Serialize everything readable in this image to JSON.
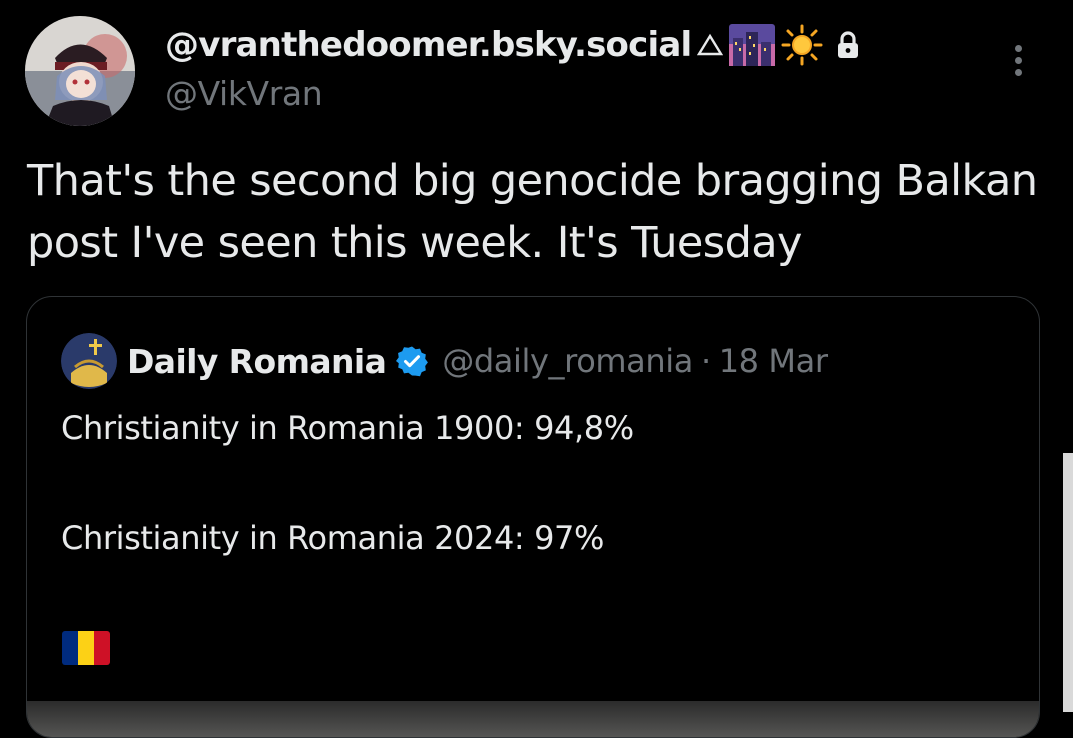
{
  "author": {
    "display_name": "@vranthedoomer.bsky.social",
    "handle": "@VikVran",
    "name_emojis": [
      "triangle-icon",
      "night-city-emoji-icon",
      "sun-emoji-icon",
      "lock-icon"
    ]
  },
  "post": {
    "text": "That's the second big genocide bragging Balkan post I've seen this week. It's Tuesday"
  },
  "quote": {
    "name": "Daily Romania",
    "handle": "@daily_romania",
    "separator": "·",
    "date": "18 Mar",
    "lines": [
      "Christianity in Romania 1900: 94,8%",
      "",
      "Christianity in Romania 2024: 97%"
    ],
    "flag_colors": [
      "#002B7F",
      "#FCD116",
      "#CE1126"
    ]
  },
  "colors": {
    "background": "#000000",
    "text": "#e7e9ea",
    "muted": "#71767b",
    "border": "#2f3336",
    "verified": "#1d9bf0"
  }
}
